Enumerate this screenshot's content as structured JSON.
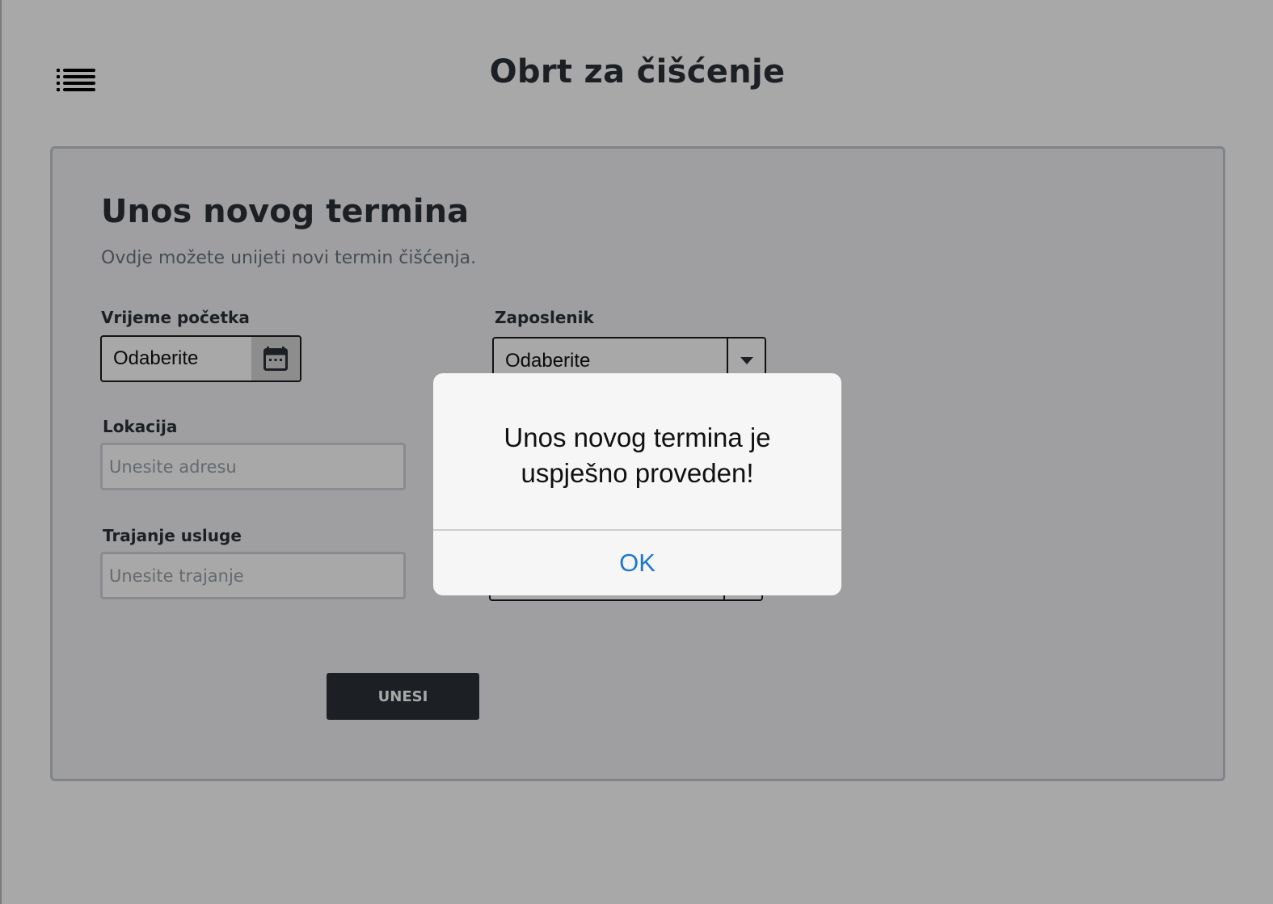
{
  "header": {
    "menu_icon": "list-menu-icon",
    "title": "Obrt za čišćenje"
  },
  "form": {
    "title": "Unos novog termina",
    "subtitle": "Ovdje možete unijeti novi termin čišćenja.",
    "start_time": {
      "label": "Vrijeme početka",
      "value": "Odaberite",
      "icon": "calendar-icon"
    },
    "employee": {
      "label": "Zaposlenik",
      "value": "Odaberite",
      "icon": "caret-down-icon"
    },
    "location": {
      "label": "Lokacija",
      "placeholder": "Unesite adresu"
    },
    "duration": {
      "label": "Trajanje usluge",
      "placeholder": "Unesite trajanje"
    },
    "submit_label": "UNESI"
  },
  "dialog": {
    "message": "Unos novog termina je uspješno proveden!",
    "ok_label": "OK"
  }
}
